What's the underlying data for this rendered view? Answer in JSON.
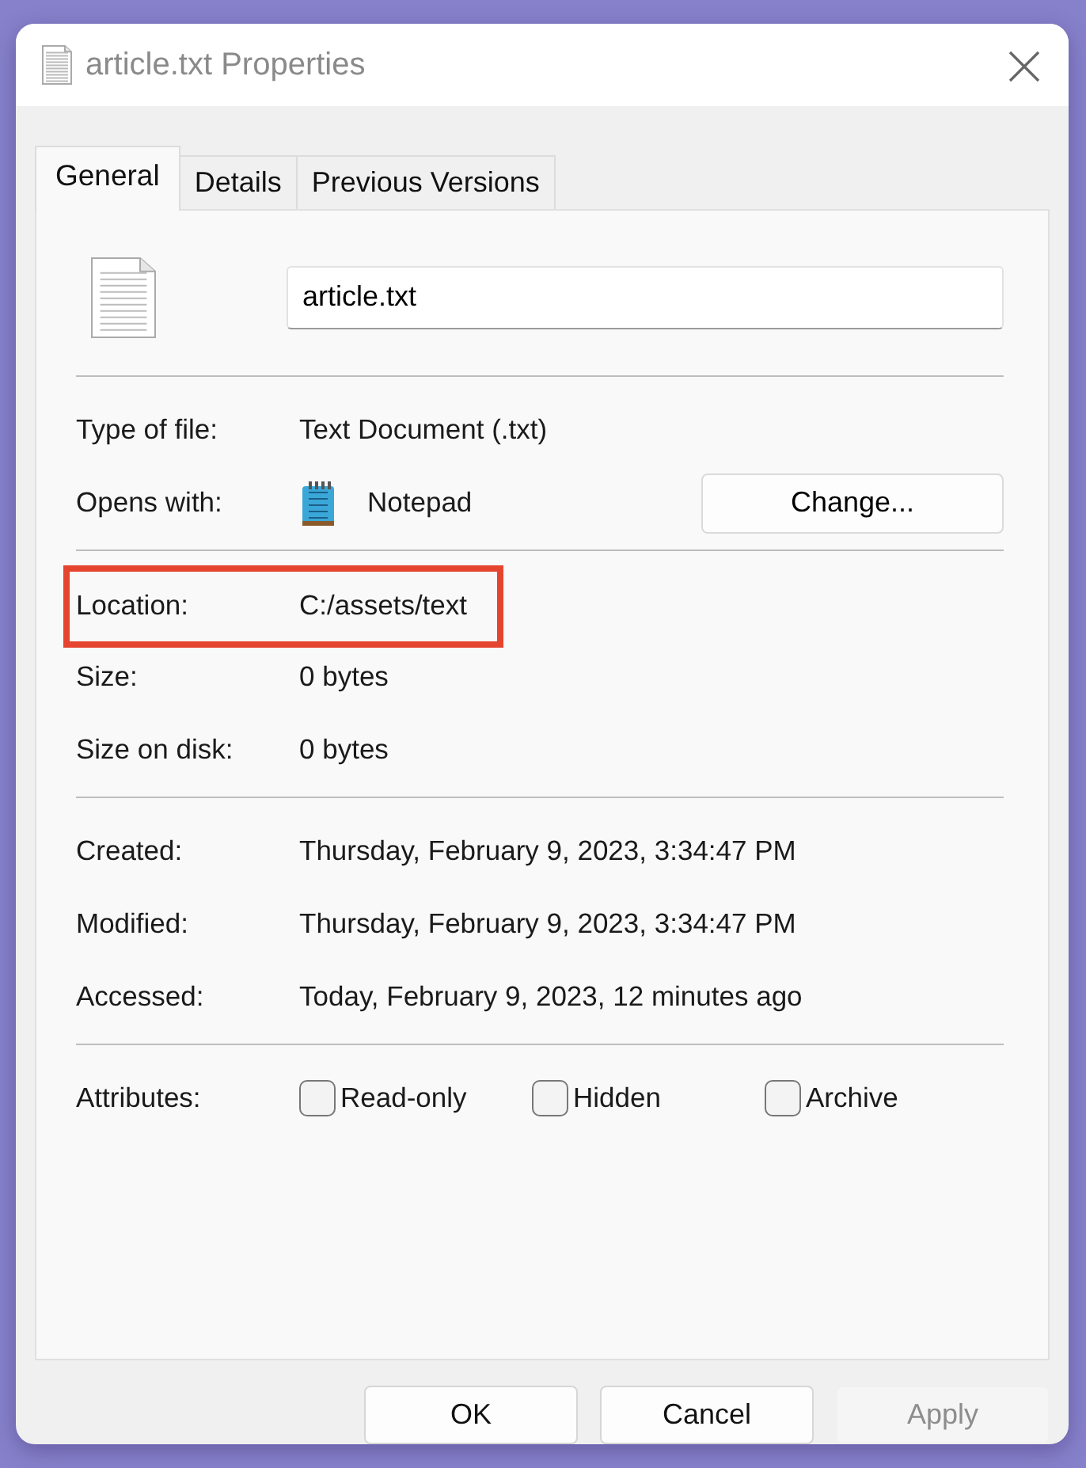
{
  "window": {
    "title": "article.txt Properties"
  },
  "tabs": [
    {
      "label": "General",
      "selected": true
    },
    {
      "label": "Details",
      "selected": false
    },
    {
      "label": "Previous Versions",
      "selected": false
    }
  ],
  "file_name": {
    "value": "article.txt"
  },
  "sections": [
    {
      "rows": [
        {
          "kind": "text",
          "label": "Type of file:",
          "value": "Text Document (.txt)"
        },
        {
          "kind": "app",
          "label": "Opens with:",
          "value": "Notepad",
          "button": "Change..."
        }
      ]
    },
    {
      "rows": [
        {
          "kind": "text",
          "label": "Location:",
          "value": "C:/assets/text",
          "highlighted": true
        },
        {
          "kind": "text",
          "label": "Size:",
          "value": "0 bytes"
        },
        {
          "kind": "text",
          "label": "Size on disk:",
          "value": "0 bytes"
        }
      ]
    },
    {
      "rows": [
        {
          "kind": "text",
          "label": "Created:",
          "value": "Thursday, February 9, 2023, 3:34:47 PM"
        },
        {
          "kind": "text",
          "label": "Modified:",
          "value": "Thursday, February 9, 2023, 3:34:47 PM"
        },
        {
          "kind": "text",
          "label": "Accessed:",
          "value": "Today, February 9, 2023, 12 minutes ago"
        }
      ]
    },
    {
      "rows": [
        {
          "kind": "attributes",
          "label": "Attributes:",
          "options": [
            {
              "label": "Read-only",
              "checked": false
            },
            {
              "label": "Hidden",
              "checked": false
            },
            {
              "label": "Archive",
              "checked": false
            }
          ]
        }
      ]
    }
  ],
  "buttons": [
    {
      "label": "OK",
      "disabled": false
    },
    {
      "label": "Cancel",
      "disabled": false
    },
    {
      "label": "Apply",
      "disabled": true
    }
  ]
}
